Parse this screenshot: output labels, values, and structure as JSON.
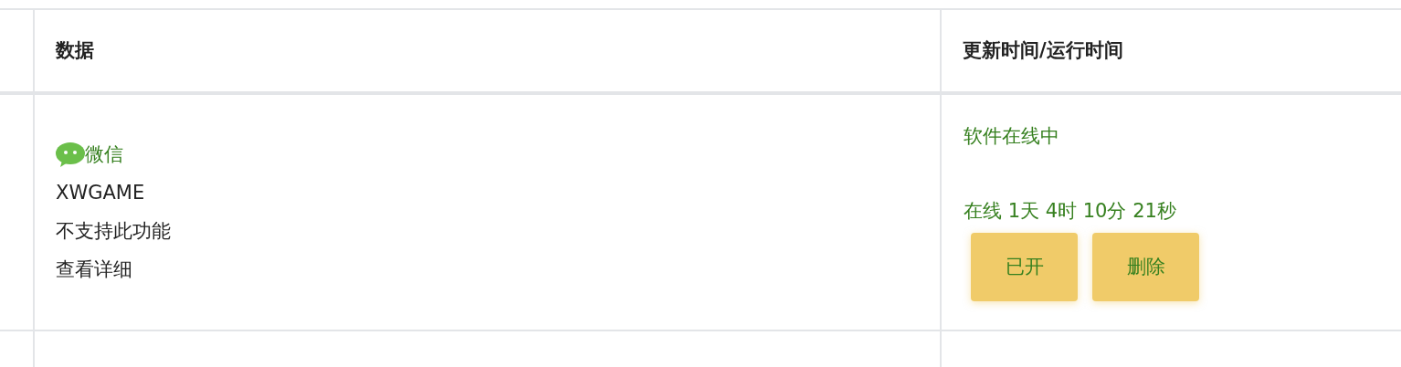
{
  "table": {
    "columns": [
      "数据",
      "更新时间/运行时间"
    ],
    "rows": [
      {
        "app": "微信",
        "account": "XWGAME",
        "note": "不支持此功能",
        "details_link": "查看详细",
        "status": "软件在线中",
        "uptime": "在线 1天 4时 10分 21秒",
        "buttons": [
          "已开",
          "删除"
        ]
      }
    ]
  }
}
